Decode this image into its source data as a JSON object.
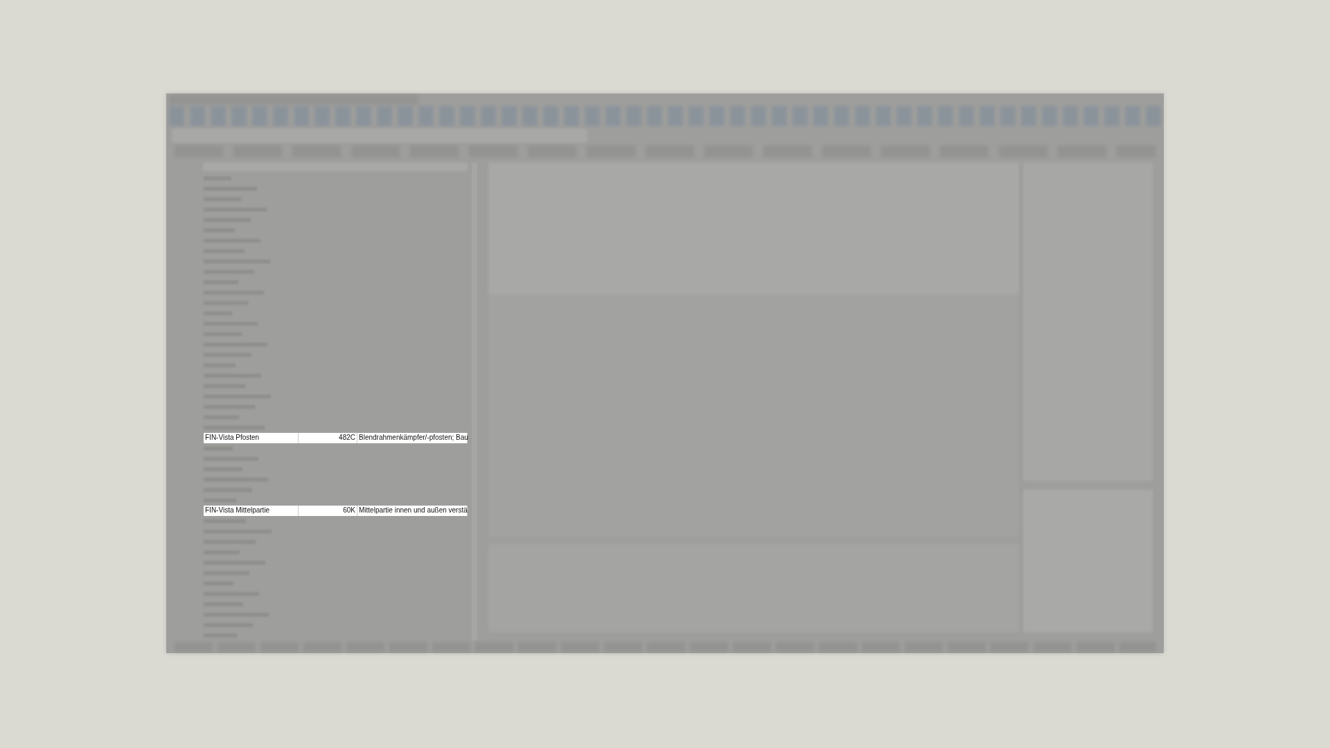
{
  "grid": {
    "rows": [
      {
        "kind": "obscured"
      },
      {
        "kind": "obscured"
      },
      {
        "kind": "obscured"
      },
      {
        "kind": "obscured"
      },
      {
        "kind": "obscured"
      },
      {
        "kind": "obscured"
      },
      {
        "kind": "obscured"
      },
      {
        "kind": "obscured"
      },
      {
        "kind": "obscured"
      },
      {
        "kind": "obscured"
      },
      {
        "kind": "obscured"
      },
      {
        "kind": "obscured"
      },
      {
        "kind": "obscured"
      },
      {
        "kind": "obscured"
      },
      {
        "kind": "obscured"
      },
      {
        "kind": "obscured"
      },
      {
        "kind": "obscured"
      },
      {
        "kind": "obscured"
      },
      {
        "kind": "obscured"
      },
      {
        "kind": "obscured"
      },
      {
        "kind": "obscured"
      },
      {
        "kind": "obscured"
      },
      {
        "kind": "obscured"
      },
      {
        "kind": "obscured"
      },
      {
        "kind": "obscured"
      },
      {
        "kind": "field",
        "attribute": "FIN-Vista Pfosten",
        "value": "482C",
        "description": "Blendrahmenkämpfer/-pfosten; Bau"
      },
      {
        "kind": "obscured"
      },
      {
        "kind": "obscured"
      },
      {
        "kind": "obscured"
      },
      {
        "kind": "obscured"
      },
      {
        "kind": "obscured"
      },
      {
        "kind": "obscured"
      },
      {
        "kind": "field",
        "attribute": "FIN-Vista Mittelpartie",
        "value": "60K",
        "description": "Mittelpartie innen und außen verstä"
      },
      {
        "kind": "obscured"
      },
      {
        "kind": "obscured"
      },
      {
        "kind": "obscured"
      },
      {
        "kind": "obscured"
      },
      {
        "kind": "obscured"
      },
      {
        "kind": "obscured"
      },
      {
        "kind": "obscured"
      },
      {
        "kind": "obscured"
      },
      {
        "kind": "obscured"
      },
      {
        "kind": "obscured"
      },
      {
        "kind": "obscured"
      },
      {
        "kind": "obscured"
      }
    ]
  }
}
